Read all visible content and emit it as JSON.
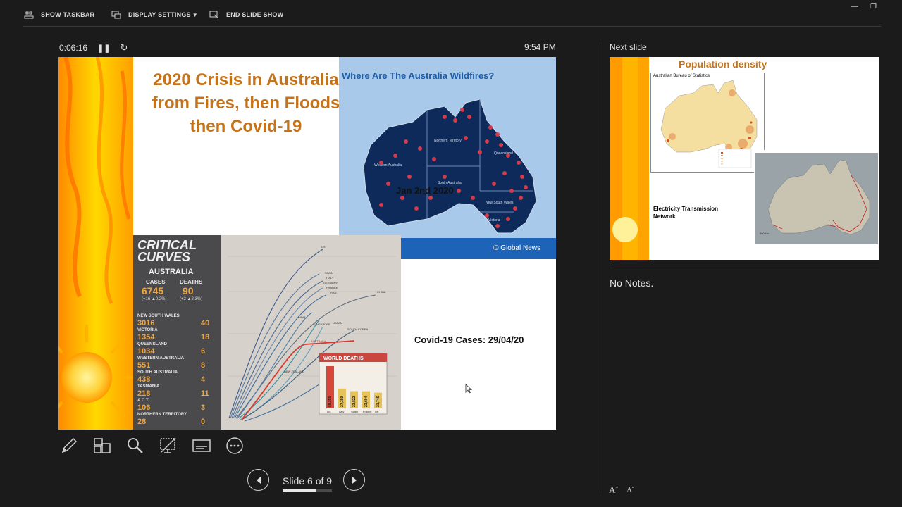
{
  "toolbar": {
    "show_taskbar": "SHOW TASKBAR",
    "display_settings": "DISPLAY SETTINGS",
    "end_slide_show": "END SLIDE SHOW"
  },
  "presenter": {
    "elapsed": "0:06:16",
    "clock": "9:54 PM",
    "slide_counter": "Slide 6 of 9",
    "progress_fraction": 0.667
  },
  "current_slide": {
    "title_lines": [
      "2020 Crisis in Australia",
      "from Fires, then Floods",
      "then Covid-19"
    ],
    "map_heading": "Where Are The Australia Wildfires?",
    "map_date": "Jan 2nd 2020",
    "map_credit": "© Global News",
    "map_regions": [
      "Western Australia",
      "Northern Territory",
      "South Australia",
      "Queensland",
      "New South Wales",
      "Victoria"
    ],
    "covid_caption": "Covid-19 Cases:  29/04/20",
    "news": {
      "headline_line1": "CRITICAL",
      "headline_line2": "CURVES",
      "country": "AUSTRALIA",
      "cases_label": "CASES",
      "deaths_label": "DEATHS",
      "cases": "6745",
      "deaths": "90",
      "cases_change": "(+16 ▲0.2%)",
      "deaths_change": "(+2 ▲2.3%)",
      "states": [
        {
          "name": "NEW SOUTH WALES",
          "cases": "3016",
          "deaths": "40"
        },
        {
          "name": "VICTORIA",
          "cases": "1354",
          "deaths": "18"
        },
        {
          "name": "QUEENSLAND",
          "cases": "1034",
          "deaths": "6"
        },
        {
          "name": "WESTERN AUSTRALIA",
          "cases": "551",
          "deaths": "8"
        },
        {
          "name": "SOUTH AUSTRALIA",
          "cases": "438",
          "deaths": "4"
        },
        {
          "name": "TASMANIA",
          "cases": "218",
          "deaths": "11"
        },
        {
          "name": "A.C.T.",
          "cases": "106",
          "deaths": "3"
        },
        {
          "name": "NORTHERN TERRITORY",
          "cases": "28",
          "deaths": "0"
        }
      ],
      "curve_labels": [
        "US",
        "SPAIN",
        "ITALY",
        "GERMANY",
        "FRANCE",
        "IRAN",
        "CHINA",
        "INDIA",
        "SINGAPORE",
        "JAPAN",
        "SOUTH KOREA",
        "AUSTRALIA",
        "NEW ZEALAND"
      ],
      "world_deaths_title": "WORLD DEATHS",
      "world_deaths": [
        {
          "country": "US",
          "value": "58,355"
        },
        {
          "country": "Italy",
          "value": "27,359"
        },
        {
          "country": "Spain",
          "value": "23,822"
        },
        {
          "country": "France",
          "value": "23,694"
        },
        {
          "country": "UK",
          "value": "21,745"
        }
      ]
    }
  },
  "next_slide": {
    "label": "Next slide",
    "title": "Population density",
    "source": "Australian Bureau of Statistics",
    "electricity_label": "Electricity Transmission Network"
  },
  "notes": {
    "text": "No Notes."
  },
  "colors": {
    "background": "#1b1b1b",
    "slide_title": "#c4731a",
    "map_ocean": "#a9c9ea",
    "map_land": "#0e2a5a",
    "fire_marker": "#d33a4a",
    "credit_bar": "#1d63b8"
  },
  "icons": {
    "tools": [
      "pen-icon",
      "see-all-slides-icon",
      "zoom-icon",
      "black-screen-icon",
      "subtitles-icon",
      "more-options-icon"
    ]
  }
}
